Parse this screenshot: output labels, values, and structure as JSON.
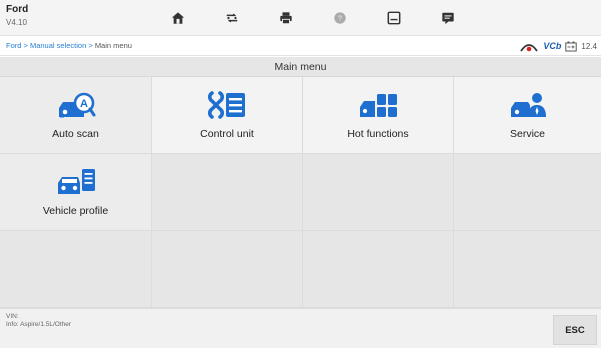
{
  "app": {
    "title": "Ford",
    "version": "V4.10"
  },
  "toolbar": {
    "items": [
      {
        "icon": "home-icon",
        "active": true
      },
      {
        "icon": "vehicle-swap-icon",
        "active": true
      },
      {
        "icon": "print-icon",
        "active": true
      },
      {
        "icon": "help-icon",
        "active": false
      },
      {
        "icon": "save-icon",
        "active": true
      },
      {
        "icon": "data-logging-icon",
        "active": true
      }
    ]
  },
  "breadcrumb": {
    "path": "Ford > Manual selection > ",
    "current": "Main menu"
  },
  "status": {
    "vci_label": "VCb",
    "battery_value": "12.4",
    "vci_color": "#e02020",
    "brand_color": "#1d5fae"
  },
  "menu": {
    "title": "Main menu",
    "tiles": [
      {
        "label": "Auto scan",
        "icon": "auto-scan-icon"
      },
      {
        "label": "Control unit",
        "icon": "control-unit-icon"
      },
      {
        "label": "Hot functions",
        "icon": "hot-functions-icon"
      },
      {
        "label": "Service",
        "icon": "service-icon"
      },
      {
        "label": "Vehicle profile",
        "icon": "vehicle-profile-icon"
      }
    ]
  },
  "footer": {
    "vin_label": "VIN:",
    "info_text": "Info: Aspire/1.5L/Other",
    "esc_label": "ESC"
  },
  "colors": {
    "icon_blue": "#1f6fd0",
    "link_blue": "#2a7fd4"
  }
}
